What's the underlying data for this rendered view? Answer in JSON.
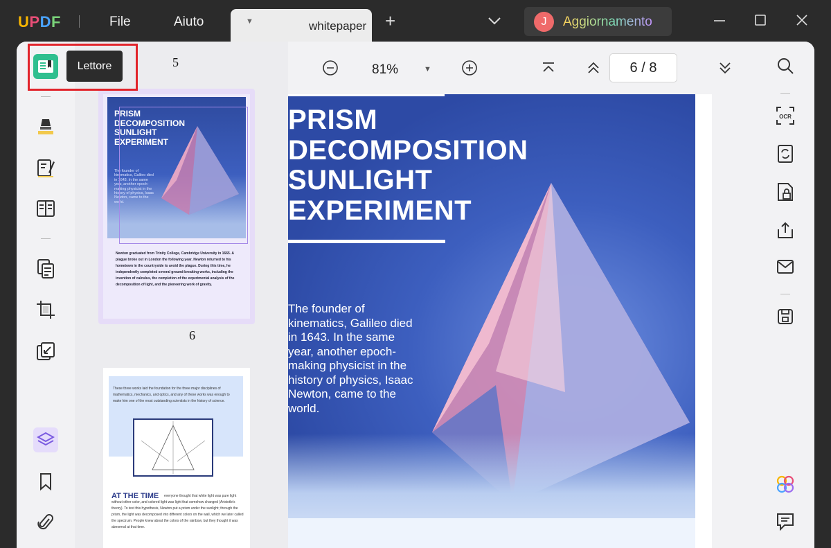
{
  "app": {
    "logo": [
      "U",
      "P",
      "D",
      "F"
    ],
    "menu": [
      "File",
      "Aiuto"
    ],
    "tab_title": "whitepaper",
    "upgrade_avatar": "J",
    "upgrade_label": "Aggiornamento"
  },
  "tooltip": "Lettore",
  "thumbnails": {
    "label_above": "5",
    "label_selected": "6",
    "page6": {
      "title": [
        "PRISM",
        "DECOMPOSITION",
        "SUNLIGHT",
        "EXPERIMENT"
      ],
      "subtext": "The founder of kinematics, Galileo died in 1643. In the same year, another epoch-making physicist in the history of physics, Isaac Newton, came to the world.",
      "body": "Newton graduated from Trinity College, Cambridge University in 1665. A plague broke out in London the following year. Newton returned to his hometown in the countryside to avoid the plague. During this time, he independently completed several ground-breaking works, including the invention of calculus, the completion of the experimental analysis of the decomposition of light, and the pioneering work of gravity."
    },
    "page7": {
      "panel_text": "These three works laid the foundation for the three major disciplines of mathematics, mechanics, and optics, and any of these works was enough to make him one of the most outstanding scientists in the history of science.",
      "heading": "AT THE TIME",
      "body": "everyone thought that white light was pure light without other color, and colored light was light that somehow changed (Aristotle's theory). To test this hypothesis, Newton put a prism under the sunlight; through the prism, the light was decomposed into different colors on the wall, which we later called the spectrum. People knew about the colors of the rainbow, but they thought it was abnormal at that time."
    }
  },
  "toolbar": {
    "zoom": "81%",
    "page_current": "6",
    "page_sep": "/",
    "page_total": "8"
  },
  "document": {
    "title": [
      "PRISM",
      "DECOMPOSITION",
      "SUNLIGHT",
      "EXPERIMENT"
    ],
    "text": "The founder of kinematics, Galileo died in 1643. In the same year, another epoch-making physicist in the history of physics, Isaac Newton, came to the world."
  },
  "colors": {
    "accent": "#8a6ee6",
    "highlight": "#e2242b",
    "reader_icon": "#2fbf8f",
    "hero_blue": "#3d5fbf"
  }
}
